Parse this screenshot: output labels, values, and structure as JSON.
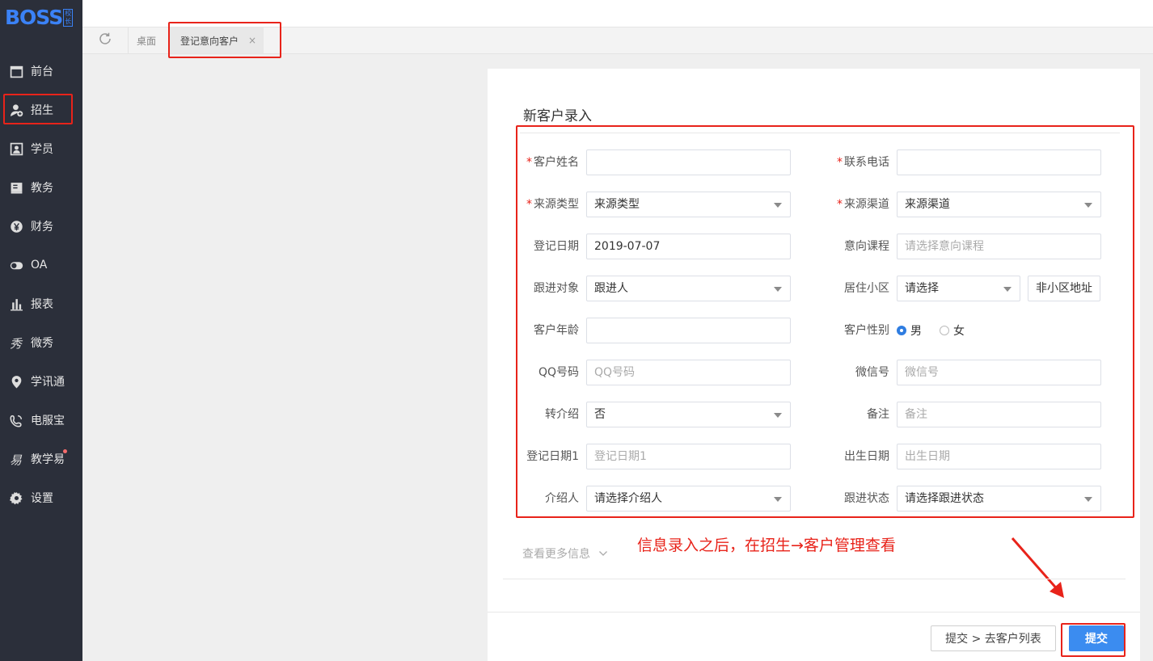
{
  "logo": {
    "text": "BOSS",
    "badge": "校长"
  },
  "sidebar": {
    "items": [
      {
        "label": "前台",
        "icon": "calendar-icon"
      },
      {
        "label": "招生",
        "icon": "user-add-icon"
      },
      {
        "label": "学员",
        "icon": "student-card-icon"
      },
      {
        "label": "教务",
        "icon": "book-icon"
      },
      {
        "label": "财务",
        "icon": "yen-icon"
      },
      {
        "label": "OA",
        "icon": "toggle-icon"
      },
      {
        "label": "报表",
        "icon": "bar-chart-icon"
      },
      {
        "label": "微秀",
        "icon": "xiu-icon"
      },
      {
        "label": "学讯通",
        "icon": "location-icon"
      },
      {
        "label": "电服宝",
        "icon": "phone-icon"
      },
      {
        "label": "教学易",
        "icon": "yi-icon"
      },
      {
        "label": "设置",
        "icon": "gear-icon"
      }
    ]
  },
  "tabs": {
    "refresh_icon": "refresh-icon",
    "desk": "桌面",
    "active": "登记意向客户",
    "close": "×"
  },
  "form": {
    "title": "新客户录入",
    "fields": {
      "name": {
        "label": "客户姓名",
        "value": ""
      },
      "phone": {
        "label": "联系电话",
        "value": ""
      },
      "source_type": {
        "label": "来源类型",
        "value": "来源类型"
      },
      "source_channel": {
        "label": "来源渠道",
        "value": "来源渠道"
      },
      "reg_date": {
        "label": "登记日期",
        "value": "2019-07-07"
      },
      "course": {
        "label": "意向课程",
        "placeholder": "请选择意向课程"
      },
      "follow_target": {
        "label": "跟进对象",
        "value": "跟进人"
      },
      "community": {
        "label": "居住小区",
        "value": "请选择",
        "extra_button": "非小区地址"
      },
      "age": {
        "label": "客户年龄",
        "value": ""
      },
      "gender": {
        "label": "客户性别",
        "options": [
          "男",
          "女"
        ],
        "selected": "男"
      },
      "qq": {
        "label": "QQ号码",
        "placeholder": "QQ号码"
      },
      "wechat": {
        "label": "微信号",
        "placeholder": "微信号"
      },
      "referral": {
        "label": "转介绍",
        "value": "否"
      },
      "remark": {
        "label": "备注",
        "placeholder": "备注"
      },
      "reg_date1": {
        "label": "登记日期1",
        "placeholder": "登记日期1"
      },
      "birthday": {
        "label": "出生日期",
        "placeholder": "出生日期"
      },
      "referrer": {
        "label": "介绍人",
        "value": "请选择介绍人"
      },
      "follow_status": {
        "label": "跟进状态",
        "value": "请选择跟进状态"
      }
    },
    "more_info": "查看更多信息",
    "annotation": "信息录入之后，在招生→客户管理查看",
    "buttons": {
      "submit_to_list": "提交 > 去客户列表",
      "submit": "提交"
    }
  },
  "colors": {
    "sidebar_bg": "#2b2f3a",
    "accent": "#3b8cf0",
    "required": "#e8231a",
    "highlight": "#e8231a"
  }
}
